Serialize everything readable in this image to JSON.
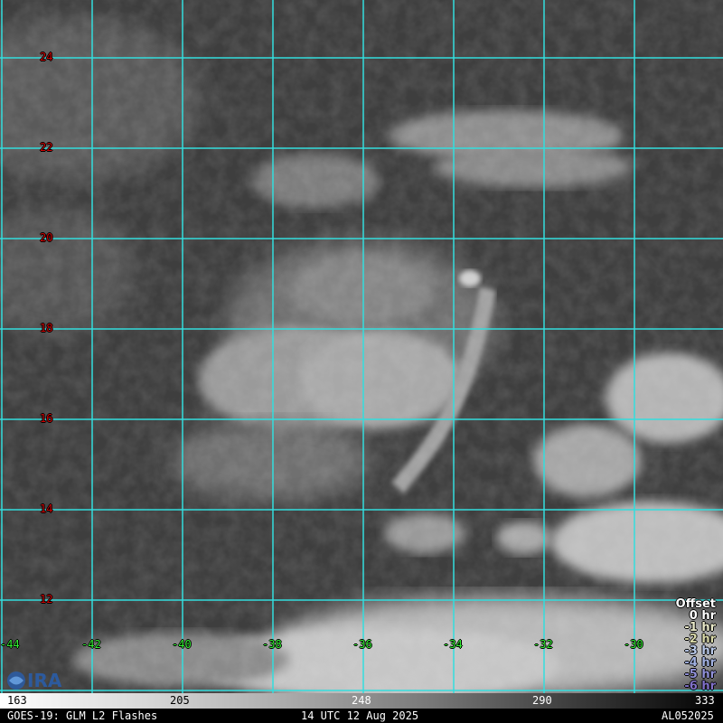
{
  "map": {
    "latitude_labels": [
      "24",
      "22",
      "20",
      "18",
      "16",
      "14",
      "12"
    ],
    "longitude_labels": [
      "-44",
      "-42",
      "-40",
      "-38",
      "-36",
      "-34",
      "-32",
      "-30"
    ]
  },
  "colorbar": {
    "ticks": [
      "163",
      "205",
      "248",
      "290",
      "333"
    ]
  },
  "legend": {
    "title": "Offset",
    "items": [
      {
        "label": "0 hr",
        "color": "#ffffff"
      },
      {
        "label": "-1 hr",
        "color": "#e8e8c8"
      },
      {
        "label": "-2 hr",
        "color": "#d8d8a8"
      },
      {
        "label": "-3 hr",
        "color": "#b8c8e8"
      },
      {
        "label": "-4 hr",
        "color": "#a0b0e0"
      },
      {
        "label": "-5 hr",
        "color": "#9090d8"
      },
      {
        "label": "-6 hr",
        "color": "#8070c8"
      }
    ]
  },
  "footer": {
    "left": "GOES-19: GLM L2 Flashes",
    "center": "14 UTC 12 Aug 2025",
    "right": "AL052025"
  },
  "colors": {
    "grid": "#33dddd",
    "lat_label": "#cc0000",
    "lon_label": "#33ee33"
  },
  "logo": {
    "icon": "cira-logo-icon"
  }
}
